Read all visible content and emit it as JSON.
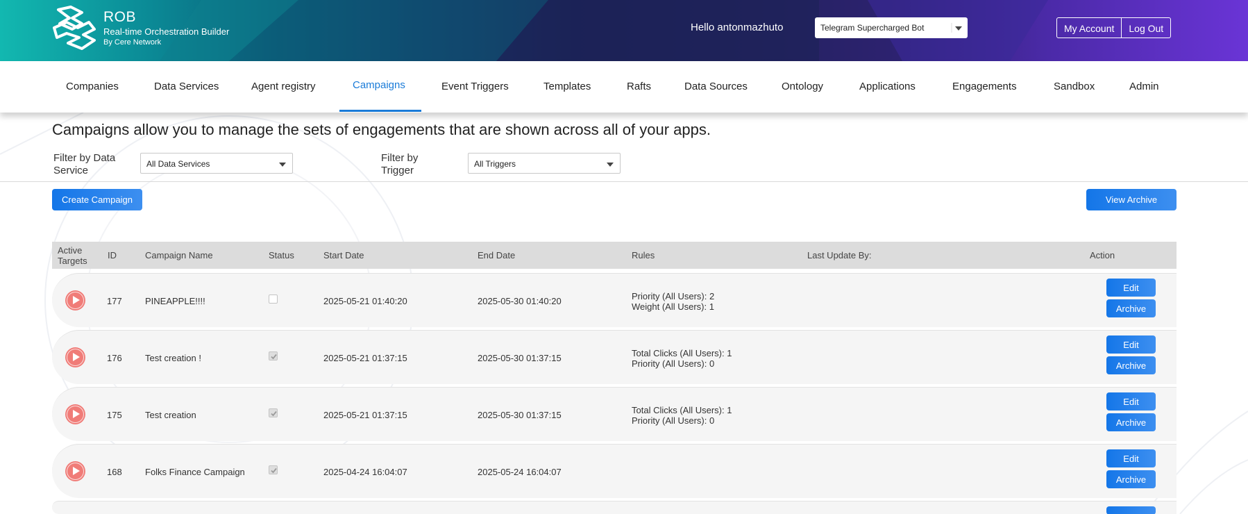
{
  "brand": {
    "name": "ROB",
    "subtitle": "Real-time Orchestration Builder",
    "byline": "By Cere Network"
  },
  "header": {
    "greeting": "Hello antonmazhuto",
    "bot_select_value": "Telegram Supercharged Bot",
    "my_account": "My Account",
    "log_out": "Log Out"
  },
  "nav": {
    "items": [
      {
        "label": "Companies"
      },
      {
        "label": "Data Services"
      },
      {
        "label": "Agent registry"
      },
      {
        "label": "Campaigns"
      },
      {
        "label": "Event Triggers"
      },
      {
        "label": "Templates"
      },
      {
        "label": "Rafts"
      },
      {
        "label": "Data Sources"
      },
      {
        "label": "Ontology"
      },
      {
        "label": "Applications"
      },
      {
        "label": "Engagements"
      },
      {
        "label": "Sandbox"
      },
      {
        "label": "Admin"
      }
    ],
    "active": "Campaigns"
  },
  "page": {
    "headline": "Campaigns allow you to manage the sets of engagements that are shown across all of your apps.",
    "filter_service_label_1": "Filter by Data",
    "filter_service_label_2": "Service",
    "filter_service_value": "All Data Services",
    "filter_trigger_label_1": "Filter by",
    "filter_trigger_label_2": "Trigger",
    "filter_trigger_value": "All Triggers",
    "create_button": "Create Campaign",
    "archive_button": "View Archive"
  },
  "table": {
    "headers": {
      "active_1": "Active",
      "active_2": "Targets",
      "id": "ID",
      "name": "Campaign Name",
      "status": "Status",
      "start": "Start Date",
      "end": "End Date",
      "rules": "Rules",
      "updated_by": "Last Update By:",
      "action": "Action"
    },
    "edit_label": "Edit",
    "archive_label": "Archive",
    "rows": [
      {
        "id": "177",
        "name": "PINEAPPLE!!!!",
        "status_checked": false,
        "start": "2025-05-21 01:40:20",
        "end": "2025-05-30 01:40:20",
        "rule1": "Priority (All Users): 2",
        "rule2": "Weight (All Users): 1"
      },
      {
        "id": "176",
        "name": "Test creation !",
        "status_checked": true,
        "start": "2025-05-21 01:37:15",
        "end": "2025-05-30 01:37:15",
        "rule1": "Total Clicks (All Users): 1",
        "rule2": "Priority (All Users): 0"
      },
      {
        "id": "175",
        "name": "Test creation",
        "status_checked": true,
        "start": "2025-05-21 01:37:15",
        "end": "2025-05-30 01:37:15",
        "rule1": "Total Clicks (All Users): 1",
        "rule2": "Priority (All Users): 0"
      },
      {
        "id": "168",
        "name": "Folks Finance Campaign",
        "status_checked": true,
        "start": "2025-04-24 16:04:07",
        "end": "2025-05-24 16:04:07",
        "rule1": "",
        "rule2": ""
      },
      {
        "id": "",
        "name": "",
        "status_checked": false,
        "start": "",
        "end": "",
        "rule1": "",
        "rule2": ""
      }
    ]
  },
  "colors": {
    "accent": "#1a7bd8",
    "button": "#1476e8",
    "play": "#f07c78"
  }
}
